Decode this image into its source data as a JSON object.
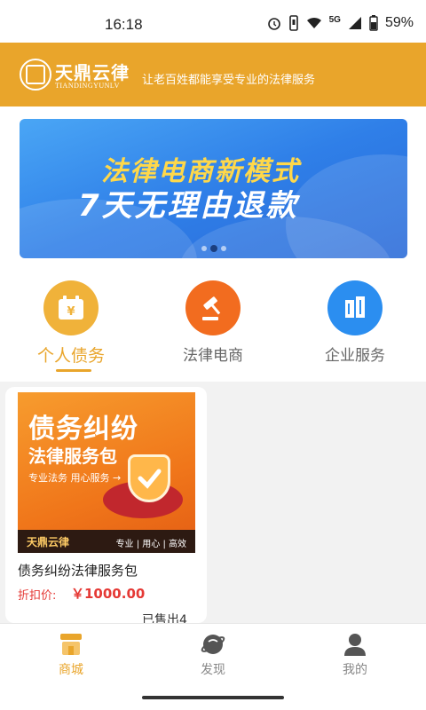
{
  "status_bar": {
    "time": "16:18",
    "network": "5G",
    "battery": "59%",
    "icons": [
      "alarm-icon",
      "vibrate-icon",
      "wifi-icon",
      "signal-icon",
      "battery-icon"
    ]
  },
  "header": {
    "brand_name": "天鼎云律",
    "brand_sub": "TIANDINGYUNLV",
    "slogan": "让老百姓都能享受专业的法律服务",
    "bg_color": "#e9a52b"
  },
  "banner": {
    "line1": "法律电商新模式",
    "line2": "7天无理由退款",
    "slides": 3,
    "active_slide": 2
  },
  "categories": [
    {
      "label": "个人债务",
      "icon": "calendar-yen-icon",
      "color": "#f0b23a",
      "active": true
    },
    {
      "label": "法律电商",
      "icon": "gavel-icon",
      "color": "#f26c1f",
      "active": false
    },
    {
      "label": "企业服务",
      "icon": "building-icon",
      "color": "#2b8ef0",
      "active": false
    }
  ],
  "product": {
    "image_title": "债务纠纷",
    "image_subtitle": "法律服务包",
    "image_tags": "专业法务  用心服务 →",
    "image_brand": "天鼎云律",
    "image_motto": "专业 | 用心 | 高效",
    "name": "债务纠纷法律服务包",
    "price_label": "折扣价:",
    "price": "￥1000.00",
    "sold": "已售出4"
  },
  "tabbar": {
    "tabs": [
      {
        "label": "商城",
        "icon": "shop-icon",
        "active": true
      },
      {
        "label": "发现",
        "icon": "planet-icon",
        "active": false
      },
      {
        "label": "我的",
        "icon": "user-icon",
        "active": false
      }
    ],
    "accent": "#e9a52b"
  }
}
